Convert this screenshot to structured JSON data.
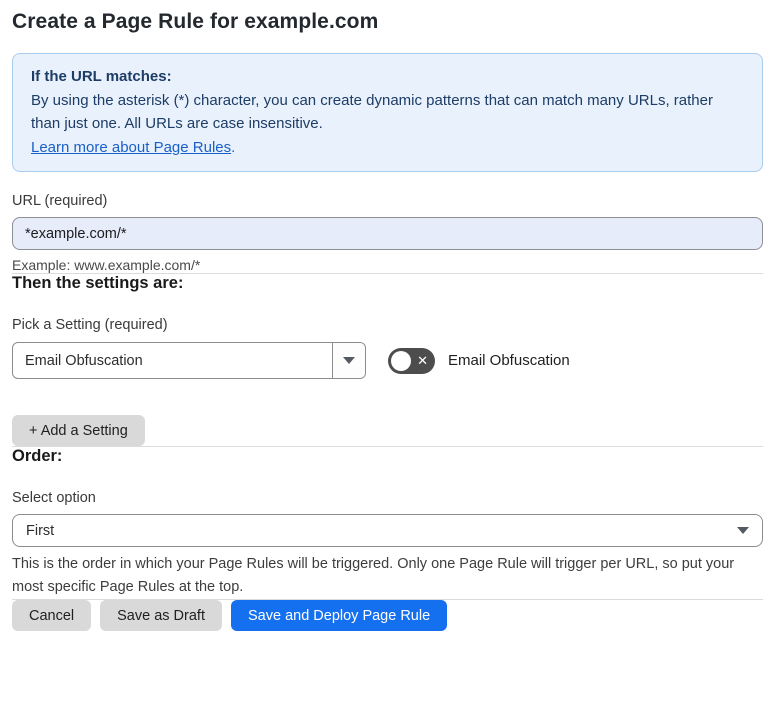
{
  "page": {
    "title": "Create a Page Rule for example.com"
  },
  "info_box": {
    "heading": "If the URL matches:",
    "body": "By using the asterisk (*) character, you can create dynamic patterns that can match many URLs, rather than just one. All URLs are case insensitive.",
    "link_label": "Learn more about Page Rules",
    "link_suffix": "."
  },
  "url_section": {
    "label": "URL (required)",
    "input_value": "*example.com/*",
    "example": "Example: www.example.com/*"
  },
  "settings_section": {
    "heading": "Then the settings are:",
    "picker_label": "Pick a Setting (required)",
    "picker_value": "Email Obfuscation",
    "toggle_state": "off",
    "toggle_icon": "✕",
    "toggle_label": "Email Obfuscation",
    "add_setting_button": "+ Add a Setting"
  },
  "order_section": {
    "heading": "Order:",
    "select_label": "Select option",
    "select_value": "First",
    "help_text": "This is the order in which your Page Rules will be triggered. Only one Page Rule will trigger per URL, so put your most specific Page Rules at the top."
  },
  "footer": {
    "cancel_label": "Cancel",
    "save_draft_label": "Save as Draft",
    "save_deploy_label": "Save and Deploy Page Rule"
  },
  "colors": {
    "info_bg": "#e9f2fc",
    "info_border": "#a9cdee",
    "info_text": "#1d3c66",
    "link": "#1a5fc8",
    "input_bg": "#e6ecfa",
    "primary_button": "#1570f0",
    "gray_button": "#d9d9d9",
    "toggle_off": "#4d4d4d"
  }
}
